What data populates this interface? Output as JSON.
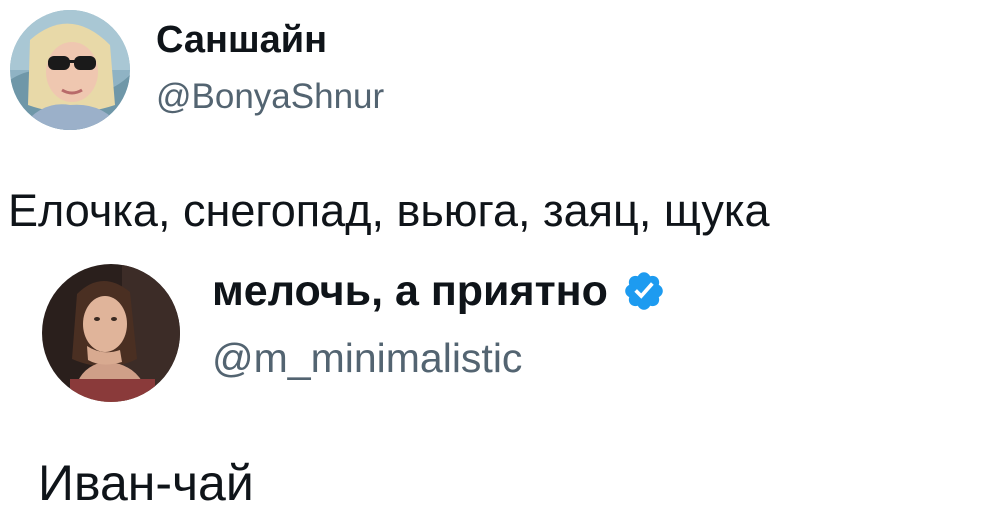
{
  "tweet": {
    "author": {
      "display_name": "Саншайн",
      "handle": "@BonyaShnur",
      "avatar_icon": "user-avatar-photo"
    },
    "text": "Елочка, снегопад, вьюга, заяц, щука"
  },
  "quoted_tweet": {
    "author": {
      "display_name": "мелочь, а приятно",
      "handle": "@m_minimalistic",
      "verified": true,
      "verified_icon": "verified-badge-icon",
      "avatar_icon": "user-avatar-photo"
    },
    "text": "Иван-чай"
  },
  "colors": {
    "text_primary": "#0f1419",
    "text_secondary": "#536471",
    "verified_blue": "#1d9bf0",
    "background": "#ffffff"
  }
}
